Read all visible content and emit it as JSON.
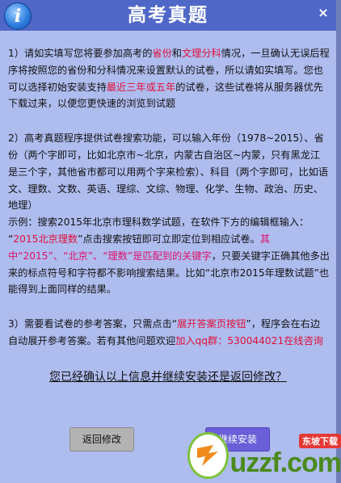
{
  "window": {
    "title": "高考真题",
    "close_glyph": "×",
    "info_glyph": "i"
  },
  "content": {
    "p1": {
      "a": "1）请如实填写您将要参加高考的",
      "b": "省份",
      "c": "和",
      "d": "文理分科",
      "e": "情况，一旦确认无误后程序将按照您的省份和分科情况来设置默认的试卷，所以请如实填写。您也可以选择初始安装支持",
      "f": "最近三年或五年",
      "g": "的试卷，这些试卷将从服务器优先下载过来，以便您更快速的浏览到试题"
    },
    "p2": {
      "a": "2）高考真题程序提供试卷搜索功能，可以输入年份（1978~2015）、省份（两个字即可，比如北京市~北京，内蒙古自治区~内蒙，只有黑龙江是三个字，其他省市都可以用两个字来检索）、科目（两个字即可，比如语文、理数、文数、英语、理综、文综、物理、化学、生物、政治、历史、地理）",
      "b": "示例：搜索2015年北京市理科数学试题，在软件下方的编辑框输入：",
      "c": "“",
      "d": "2015北京理数",
      "e": "”点击搜索按钮即可立即定位到相应试卷。",
      "f": "其中“2015”、“北京”、“理数”是匹配到的关键字",
      "g": "，只要关键字正确其他多出来的标点符号和字符都不影响搜索结果。比如“北京市2015年理数试题”也能得到上面同样的结果。"
    },
    "p3": {
      "a": "3）需要看试卷的参考答案，只需点击“",
      "b": "展开答案页按钮",
      "c": "”，程序会在右边自动展开参考答案。若有其他问题欢迎",
      "d": "加入qq群：530044021在线咨询"
    }
  },
  "confirm_text": "您已经确认以上信息并继续安装还是返回修改？",
  "buttons": {
    "back": "返回修改",
    "next": "继续安装"
  },
  "watermark": {
    "top": "东坡下载",
    "brand": "uzzf.com"
  }
}
